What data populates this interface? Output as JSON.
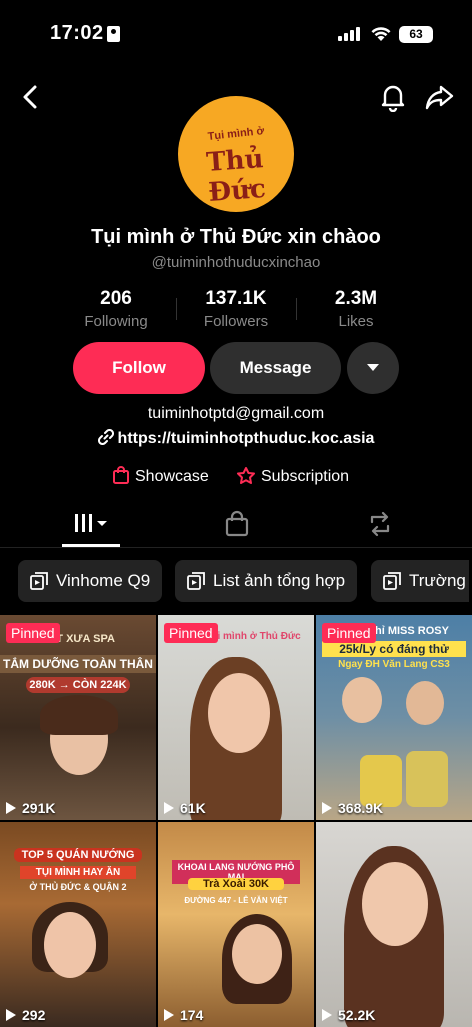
{
  "status": {
    "time": "17:02",
    "battery": "63"
  },
  "profile": {
    "avatar_text_small": "Tụi mình ở",
    "avatar_text": "Thủ Đức",
    "display_name": "Tụi mình ở Thủ Đức xin chàoo",
    "username": "@tuiminhothuducxinchao"
  },
  "stats": [
    {
      "value": "206",
      "label": "Following"
    },
    {
      "value": "137.1K",
      "label": "Followers"
    },
    {
      "value": "2.3M",
      "label": "Likes"
    }
  ],
  "actions": {
    "follow": "Follow",
    "message": "Message"
  },
  "bio": {
    "email": "tuiminhotptd@gmail.com",
    "link": "https://tuiminhotpthuduc.koc.asia"
  },
  "links": {
    "showcase": "Showcase",
    "subscription": "Subscription"
  },
  "playlists": [
    "Vinhome Q9",
    "List ảnh tổng hợp",
    "Trường h"
  ],
  "videos": [
    {
      "pinned": "Pinned",
      "views": "291K",
      "caption_top": "NÉT XƯA SPA",
      "caption_main": "TẮM DƯỠNG TOÀN THÂN",
      "caption_price": "280K → CÒN 224K"
    },
    {
      "pinned": "Pinned",
      "views": "61K",
      "caption_top": "Tụi mình ở Thủ Đức",
      "caption_main": "",
      "caption_price": ""
    },
    {
      "pinned": "Pinned",
      "views": "368.9K",
      "caption_top": "Chỉ MISS ROSY",
      "caption_main": "25k/Ly có đáng thử",
      "caption_price": "Ngay ĐH Văn Lang CS3"
    },
    {
      "pinned": "",
      "views": "292",
      "caption_top": "TOP 5 QUÁN NƯỚNG",
      "caption_main": "TỤI MÌNH HAY ĂN",
      "caption_price": "Ở THỦ ĐỨC & QUẬN 2"
    },
    {
      "pinned": "",
      "views": "174",
      "caption_top": "KHOAI LANG NƯỚNG PHÔ MAI",
      "caption_main": "Trà Xoài 30K",
      "caption_price": "ĐƯỜNG 447 - LÊ VĂN VIỆT"
    },
    {
      "pinned": "",
      "views": "52.2K",
      "caption_top": "",
      "caption_main": "",
      "caption_price": ""
    }
  ],
  "colors": {
    "accent": "#fe2c55",
    "avatar_bg": "#f7a823",
    "chip_bg": "#232323"
  },
  "icons": [
    "back-icon",
    "bell-icon",
    "share-icon",
    "link-icon",
    "showcase-bag-icon",
    "subscription-icon",
    "grid-icon",
    "shop-icon",
    "repost-icon",
    "playlist-icon",
    "play-icon"
  ]
}
